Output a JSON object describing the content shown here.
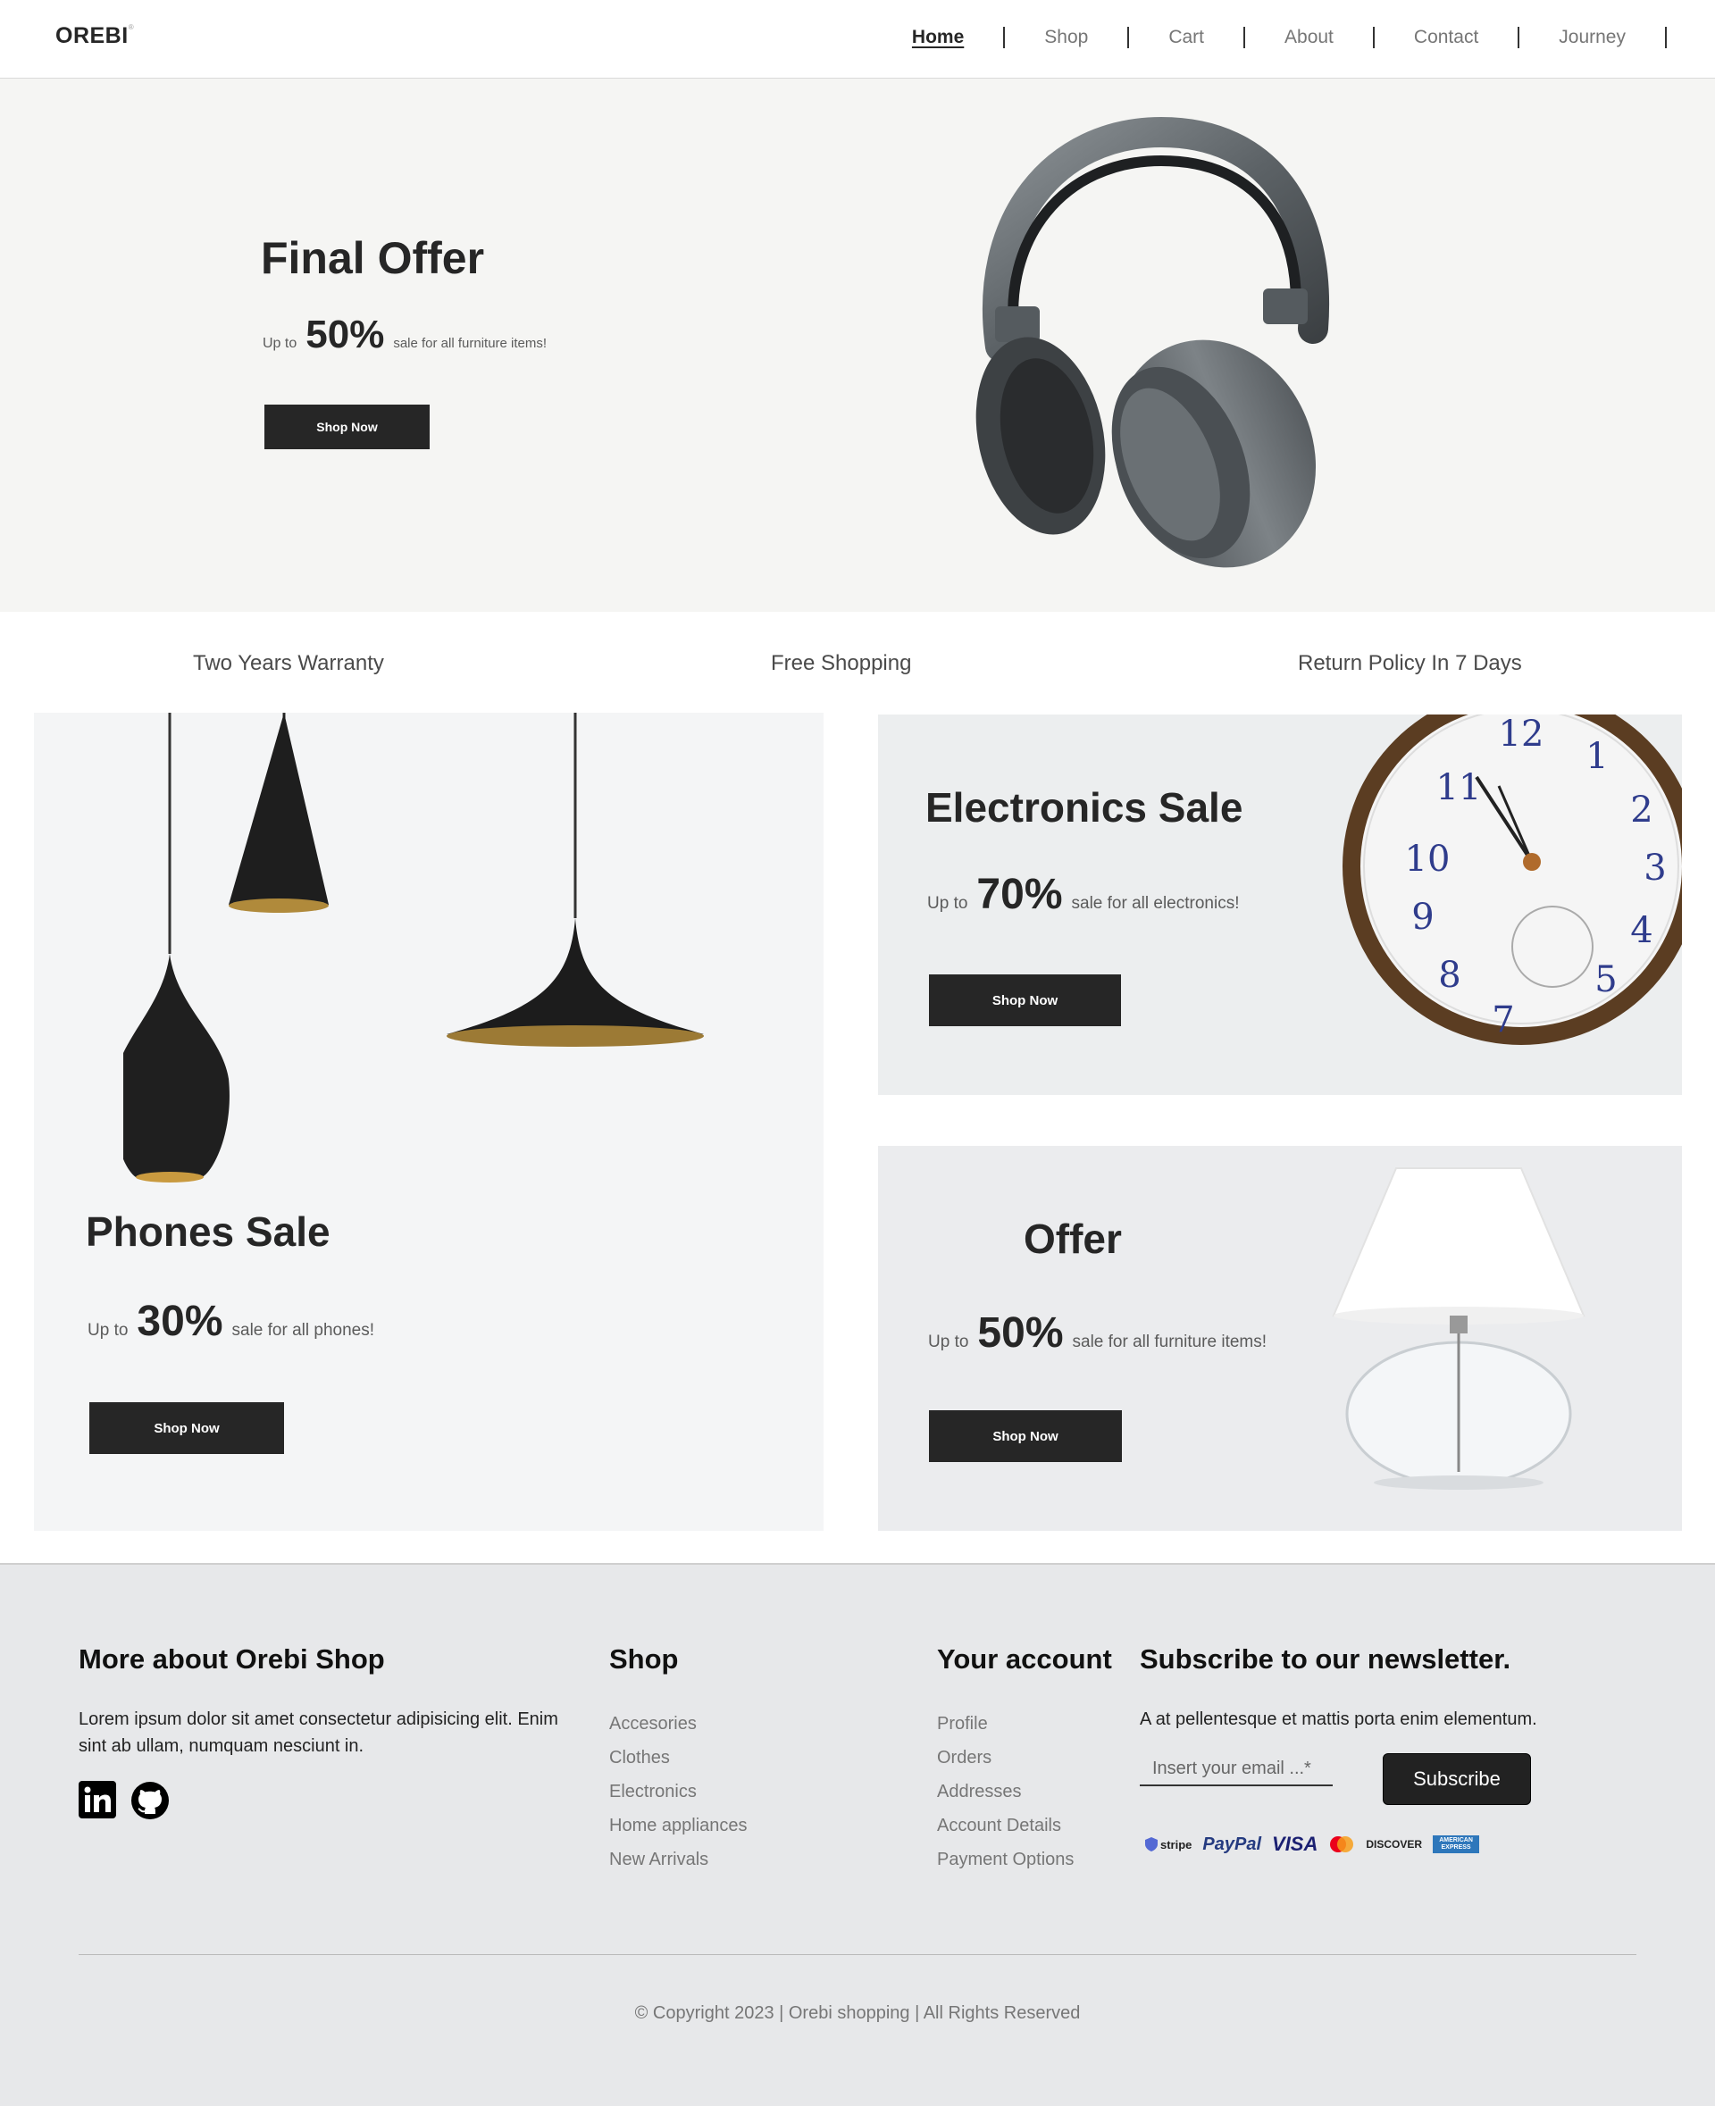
{
  "brand": {
    "logo": "OREBI"
  },
  "nav": {
    "items": [
      {
        "label": "Home",
        "active": true
      },
      {
        "label": "Shop"
      },
      {
        "label": "Cart"
      },
      {
        "label": "About"
      },
      {
        "label": "Contact"
      },
      {
        "label": "Journey"
      }
    ]
  },
  "hero": {
    "title": "Final Offer",
    "up_to": "Up to",
    "percent": "50%",
    "description": "sale for all furniture items!",
    "button": "Shop Now"
  },
  "features": [
    "Two Years Warranty",
    "Free Shopping",
    "Return Policy In 7 Days"
  ],
  "promos": {
    "phones": {
      "title": "Phones Sale",
      "up_to": "Up to",
      "percent": "30%",
      "description": "sale for all phones!",
      "button": "Shop Now"
    },
    "electronics": {
      "title": "Electronics Sale",
      "up_to": "Up to",
      "percent": "70%",
      "description": "sale for all electronics!",
      "button": "Shop Now"
    },
    "offer": {
      "title": "Offer",
      "up_to": "Up to",
      "percent": "50%",
      "description": "sale for all furniture items!",
      "button": "Shop Now"
    }
  },
  "footer": {
    "about": {
      "heading": "More about Orebi Shop",
      "text": "Lorem ipsum dolor sit amet consectetur adipisicing elit. Enim sint ab ullam, numquam nesciunt in."
    },
    "shop": {
      "heading": "Shop",
      "links": [
        "Accesories",
        "Clothes",
        "Electronics",
        "Home appliances",
        "New Arrivals"
      ]
    },
    "account": {
      "heading": "Your account",
      "links": [
        "Profile",
        "Orders",
        "Addresses",
        "Account Details",
        "Payment Options"
      ]
    },
    "newsletter": {
      "heading": "Subscribe to our newsletter.",
      "text": "A at pellentesque et mattis porta enim elementum.",
      "email_placeholder": "Insert your email ...*",
      "button": "Subscribe",
      "payment_methods": [
        "stripe",
        "PayPal",
        "VISA",
        "mastercard",
        "DISCOVER",
        "AMERICAN EXPRESS"
      ]
    },
    "copyright": "© Copyright 2023 | Orebi shopping | All Rights Reserved"
  }
}
